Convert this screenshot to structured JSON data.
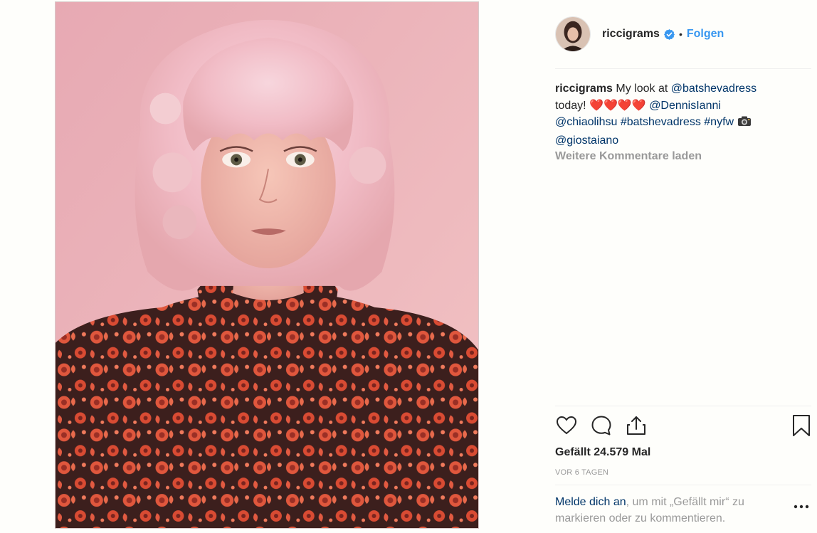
{
  "post": {
    "author": {
      "username": "riccigrams",
      "verified": true
    },
    "follow_separator": "•",
    "follow_label": "Folgen",
    "caption": {
      "username": "riccigrams",
      "text1": "My look at",
      "mention1": "@batshevadress",
      "text2": "today!",
      "hearts": [
        "❤️",
        "❤️",
        "❤️",
        "❤️"
      ],
      "mention2": "@DennisIanni",
      "mention3": "@chiaolihsu",
      "hashtag1": "#batshevadress",
      "hashtag2": "#nyfw",
      "camera_icon": "camera-icon",
      "mention4": "@giostaiano"
    },
    "load_more_comments": "Weitere Kommentare laden",
    "likes_text": "Gefällt 24.579 Mal",
    "time_ago": "VOR 6 TAGEN",
    "login_prompt": {
      "link": "Melde dich an",
      "text": ", um mit „Gefällt mir“ zu markieren oder zu kommentieren."
    },
    "icons": {
      "like": "heart-outline-icon",
      "comment": "comment-bubble-icon",
      "share": "share-icon",
      "save": "bookmark-icon",
      "more": "more-options-icon",
      "verified": "verified-badge-icon"
    },
    "colors": {
      "link": "#003569",
      "follow": "#3897f0",
      "verified": "#3897f0",
      "muted": "#999999",
      "text": "#262626"
    }
  }
}
